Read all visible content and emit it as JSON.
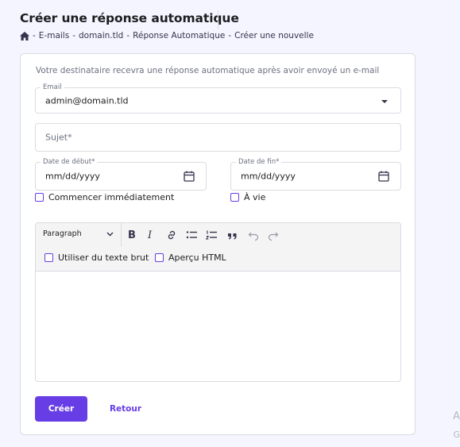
{
  "header": {
    "title": "Créer une réponse automatique",
    "breadcrumb": [
      "E-mails",
      "domain.tld",
      "Réponse Automatique",
      "Créer une nouvelle"
    ],
    "breadcrumb_separator": "-"
  },
  "form": {
    "intro": "Votre destinataire recevra une réponse automatique après avoir envoyé un e-mail",
    "email": {
      "label": "Email",
      "value": "admin@domain.tld"
    },
    "subject": {
      "placeholder": "Sujet*"
    },
    "start_date": {
      "label": "Date de début*",
      "value": "mm/dd/yyyy"
    },
    "end_date": {
      "label": "Date de fin*",
      "value": "mm/dd/yyyy"
    },
    "start_now": {
      "label": "Commencer immédiatement",
      "checked": false
    },
    "forever": {
      "label": "À vie",
      "checked": false
    }
  },
  "editor": {
    "block_format": "Paragraph",
    "toolbar_icons": [
      "bold-icon",
      "italic-icon",
      "link-icon",
      "bullet-list-icon",
      "numbered-list-icon",
      "quote-icon",
      "undo-icon",
      "redo-icon"
    ],
    "bold_glyph": "B",
    "italic_glyph": "I",
    "plain_text": {
      "label": "Utiliser du texte brut",
      "checked": false
    },
    "html_preview": {
      "label": "Aperçu HTML",
      "checked": false
    },
    "content": ""
  },
  "actions": {
    "create_label": "Créer",
    "back_label": "Retour"
  },
  "edge_fragments": {
    "first": "A",
    "second": "G"
  },
  "colors": {
    "accent": "#673de6",
    "text": "#1d1e20",
    "muted": "#6d7081",
    "border": "#dadce0",
    "page_bg": "#f4f5ff"
  }
}
